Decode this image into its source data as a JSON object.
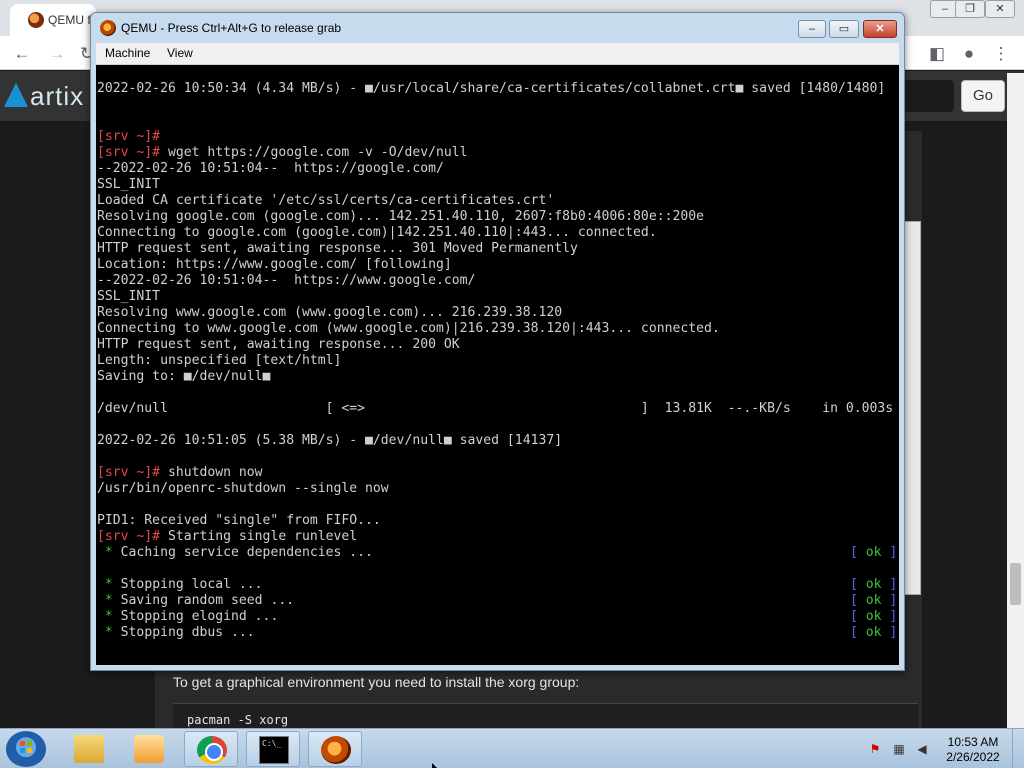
{
  "browser": {
    "tab_title": "QEMU fo",
    "nav": {
      "back_icon": "back-arrow-icon",
      "forward_icon": "forward-arrow-icon",
      "reload_icon": "reload-icon"
    },
    "logo_text": "artix",
    "go_label": "Go",
    "page": {
      "install_text": "To get a graphical environment you need to install the xorg group:",
      "code": "pacman -S xorg"
    }
  },
  "qemu": {
    "title": "QEMU - Press Ctrl+Alt+G to release grab",
    "menu": [
      "Machine",
      "View"
    ],
    "terminal": {
      "lines": [
        "2022-02-26 10:50:34 (4.34 MB/s) - ■/usr/local/share/ca-certificates/collabnet.crt■ saved [1480/1480]",
        "",
        "",
        "[srv ~]#",
        "[srv ~]# wget https://google.com -v -O/dev/null",
        "--2022-02-26 10:51:04--  https://google.com/",
        "SSL_INIT",
        "Loaded CA certificate '/etc/ssl/certs/ca-certificates.crt'",
        "Resolving google.com (google.com)... 142.251.40.110, 2607:f8b0:4006:80e::200e",
        "Connecting to google.com (google.com)|142.251.40.110|:443... connected.",
        "HTTP request sent, awaiting response... 301 Moved Permanently",
        "Location: https://www.google.com/ [following]",
        "--2022-02-26 10:51:04--  https://www.google.com/",
        "SSL_INIT",
        "Resolving www.google.com (www.google.com)... 216.239.38.120",
        "Connecting to www.google.com (www.google.com)|216.239.38.120|:443... connected.",
        "HTTP request sent, awaiting response... 200 OK",
        "Length: unspecified [text/html]",
        "Saving to: ■/dev/null■",
        "",
        "/dev/null                    [ <=>                                   ]  13.81K  --.-KB/s    in 0.003s",
        "",
        "2022-02-26 10:51:05 (5.38 MB/s) - ■/dev/null■ saved [14137]",
        "",
        "[srv ~]# shutdown now",
        "/usr/bin/openrc-shutdown --single now",
        "",
        "PID1: Received \"single\" from FIFO...",
        "[srv ~]# Starting single runlevel",
        " * Caching service dependencies ...",
        "",
        " * Stopping local ...",
        " * Saving random seed ...",
        " * Stopping elogind ...",
        " * Stopping dbus ..."
      ],
      "prompt": "[srv ~]#",
      "ok_label": "ok"
    }
  },
  "taskbar": {
    "clock_time": "10:53 AM",
    "clock_date": "2/26/2022",
    "cmd_text": "C:\\_"
  }
}
